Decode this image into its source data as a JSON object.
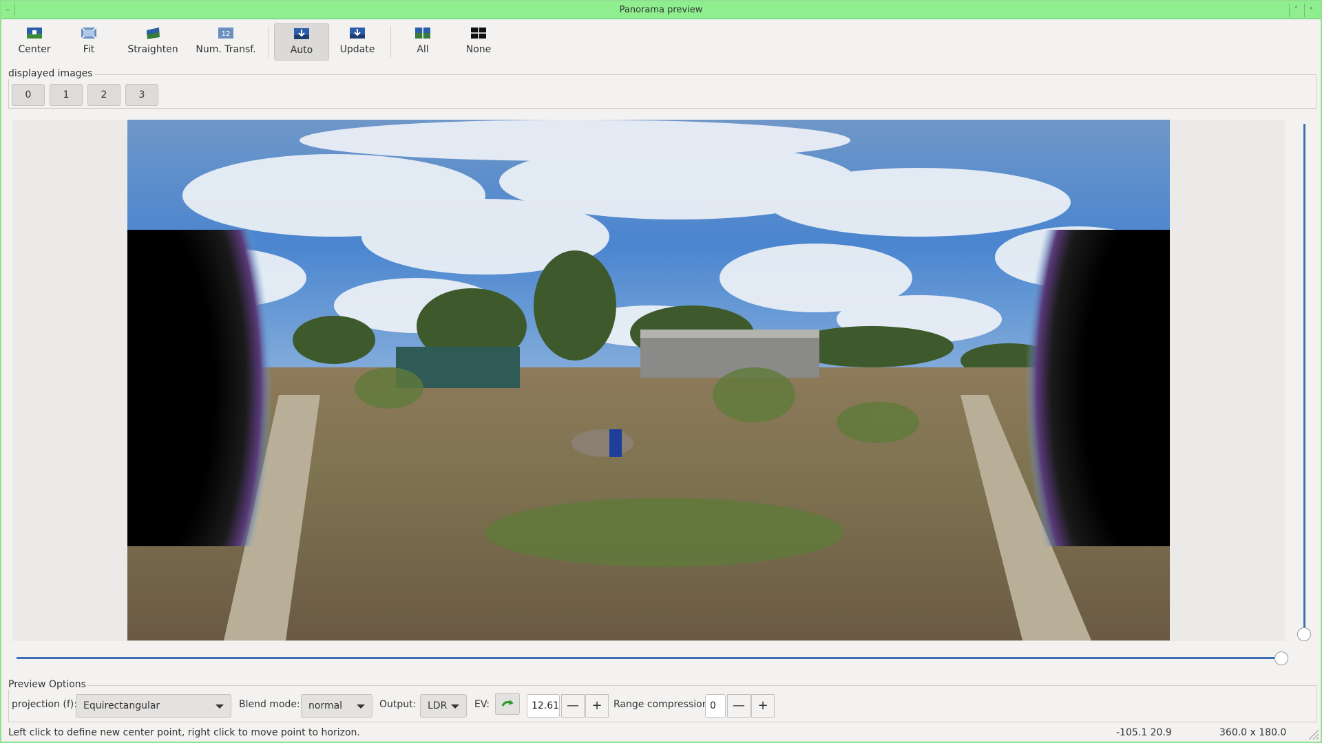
{
  "window": {
    "title": "Panorama preview"
  },
  "toolbar": {
    "items": [
      {
        "label": "Center",
        "icon": "center-icon"
      },
      {
        "label": "Fit",
        "icon": "fit-icon"
      },
      {
        "label": "Straighten",
        "icon": "straighten-icon"
      },
      {
        "label": "Num. Transf.",
        "icon": "numeric-transform-icon"
      },
      {
        "label": "Auto",
        "icon": "auto-icon",
        "active": true
      },
      {
        "label": "Update",
        "icon": "update-icon"
      },
      {
        "label": "All",
        "icon": "all-icon"
      },
      {
        "label": "None",
        "icon": "none-icon"
      }
    ]
  },
  "displayed_images": {
    "label": "displayed images",
    "buttons": [
      "0",
      "1",
      "2",
      "3"
    ]
  },
  "preview_options": {
    "label": "Preview Options",
    "projection_label": "projection (f):",
    "projection_value": "Equirectangular",
    "blend_label": "Blend mode:",
    "blend_value": "normal",
    "output_label": "Output:",
    "output_value": "LDR",
    "ev_label": "EV:",
    "ev_value": "12.61",
    "range_label": "Range compression:",
    "range_value": "0",
    "minus": "—",
    "plus": "+"
  },
  "status": {
    "message": "Left click to define new center point, right click to move point to horizon.",
    "coords": "-105.1 20.9",
    "fov": "360.0 x 180.0"
  },
  "colors": {
    "accent": "#3d6fb5",
    "titlebar": "#8fef8f"
  }
}
